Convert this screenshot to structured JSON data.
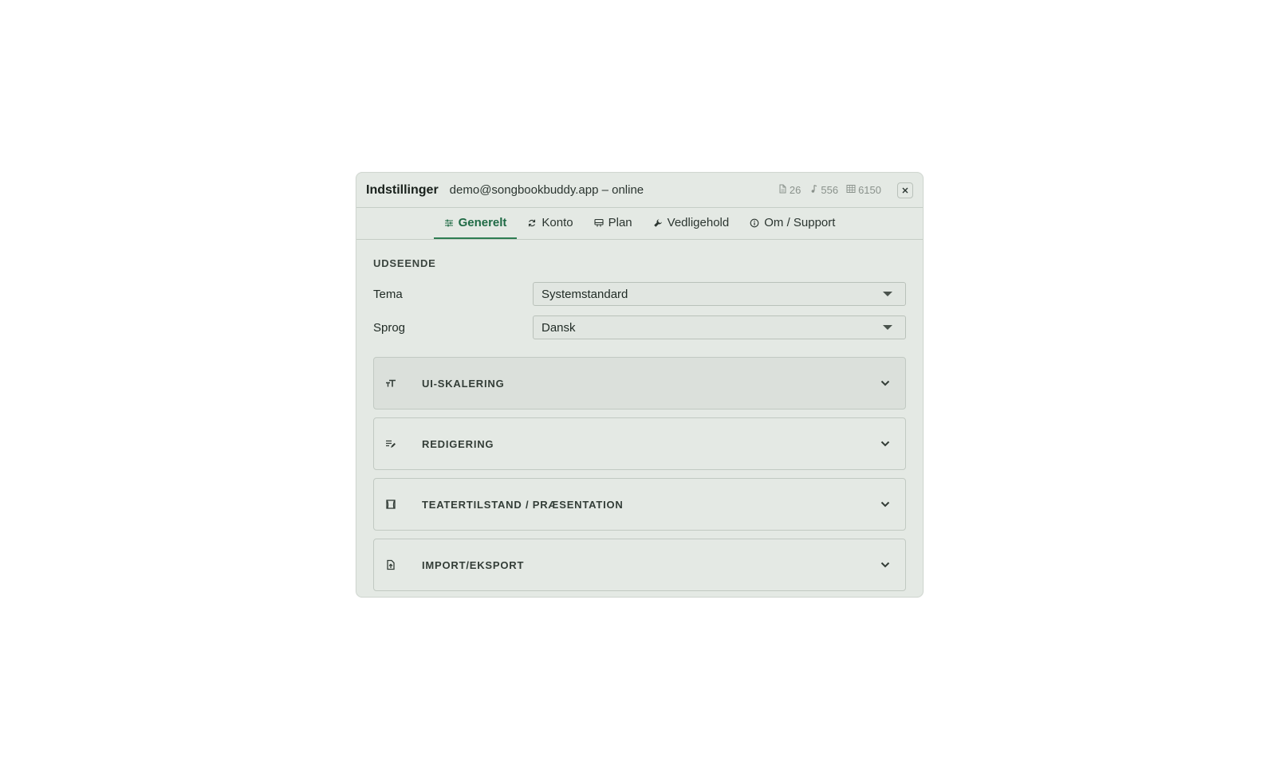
{
  "header": {
    "title": "Indstillinger",
    "account": "demo@songbookbuddy.app – online",
    "stats": [
      {
        "icon": "document-icon",
        "value": "26"
      },
      {
        "icon": "music-note-icon",
        "value": "556"
      },
      {
        "icon": "grid-icon",
        "value": "6150"
      }
    ],
    "close_icon": "close-icon"
  },
  "tabs": [
    {
      "label": "Generelt",
      "icon": "sliders-icon",
      "active": true
    },
    {
      "label": "Konto",
      "icon": "sync-icon",
      "active": false
    },
    {
      "label": "Plan",
      "icon": "monitor-icon",
      "active": false
    },
    {
      "label": "Vedligehold",
      "icon": "wrench-icon",
      "active": false
    },
    {
      "label": "Om / Support",
      "icon": "info-icon",
      "active": false
    }
  ],
  "appearance": {
    "heading": "UDSEENDE",
    "theme_label": "Tema",
    "theme_value": "Systemstandard",
    "language_label": "Sprog",
    "language_value": "Dansk"
  },
  "sections": [
    {
      "label": "UI-SKALERING",
      "icon": "text-size-icon"
    },
    {
      "label": "REDIGERING",
      "icon": "edit-note-icon"
    },
    {
      "label": "TEATERTILSTAND / PRÆSENTATION",
      "icon": "theater-icon"
    },
    {
      "label": "IMPORT/EKSPORT",
      "icon": "file-upload-icon"
    }
  ],
  "colors": {
    "accent": "#2e7d52",
    "panel": "#e4e9e4"
  }
}
